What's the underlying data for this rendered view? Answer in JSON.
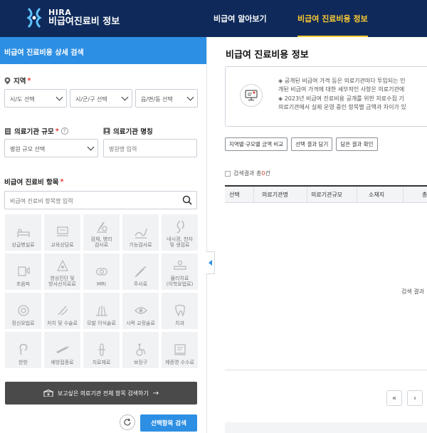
{
  "header": {
    "logo_en": "HIRA",
    "logo_ko": "비급여진료비 정보",
    "nav": [
      {
        "label": "비급여 알아보기"
      },
      {
        "label": "비급여 진료비용 정보"
      }
    ]
  },
  "left": {
    "title": "비급여 진료비용 상세 검색",
    "region": {
      "label": "지역",
      "required": "*",
      "sido": "시/도 선택",
      "sigungu": "시/군/구 선택",
      "eupmyeon": "읍/면/동 선택"
    },
    "scale": {
      "label": "의료기관 규모",
      "required": "*",
      "help": "?",
      "placeholder": "병원 규모 선택"
    },
    "name": {
      "label": "의료기관 명칭",
      "placeholder": "병원명 입력"
    },
    "items": {
      "label": "비급여 진료비 항목",
      "required": "*",
      "search_placeholder": "비급여 진료비 항목명 입력",
      "categories": [
        {
          "icon": "bed-icon",
          "label": "상급병실료"
        },
        {
          "icon": "counseling-icon",
          "label": "교육상담료"
        },
        {
          "icon": "pathology-icon",
          "label": "검체, 병리\n검사료"
        },
        {
          "icon": "function-test-icon",
          "label": "기능검사료"
        },
        {
          "icon": "endoscopy-icon",
          "label": "내시경, 천자\n및 생검료"
        },
        {
          "icon": "ultrasound-icon",
          "label": "초음파"
        },
        {
          "icon": "radiology-icon",
          "label": "영상진단 및\n방사선치료료"
        },
        {
          "icon": "mri-icon",
          "label": "MRI"
        },
        {
          "icon": "injection-icon",
          "label": "주사료"
        },
        {
          "icon": "therapy-icon",
          "label": "물리치료\n(이학요법료)"
        },
        {
          "icon": "psychiatry-icon",
          "label": "정신요법료"
        },
        {
          "icon": "surgery-icon",
          "label": "처치 및 수술료"
        },
        {
          "icon": "hair-icon",
          "label": "모발 이식술료"
        },
        {
          "icon": "eye-icon",
          "label": "시력 교정술료"
        },
        {
          "icon": "tooth-icon",
          "label": "치과"
        },
        {
          "icon": "ear-icon",
          "label": "한방"
        },
        {
          "icon": "vaccine-icon",
          "label": "예방접종료"
        },
        {
          "icon": "material-icon",
          "label": "치료재료"
        },
        {
          "icon": "wheelchair-icon",
          "label": "보장구"
        },
        {
          "icon": "certificate-icon",
          "label": "제증명 수수료"
        }
      ]
    },
    "full_search": "보고싶은 의료기관 전체 항목 검색하기",
    "full_search_arrow": "→",
    "submit": "선택항목 검색"
  },
  "right": {
    "title": "비급여 진료비용 정보",
    "notice_lines": [
      "◈ 공개된 비급여 가격 등은 의료기관마다 투입되는 인",
      "개된 비급여 가격에 대한 세부적인 사항은 의료기관에",
      "◈ 2023년 비급여 진료비용 공개를 위한 자료수집 기",
      "의료기관에서 실제 운영 중인 항목별 금액과 차이가 있"
    ],
    "buttons": [
      "지역별·규모별 금액 비교",
      "선택 결과 담기",
      "담은 결과 확인"
    ],
    "count_prefix": "검색결과 총",
    "count_value": "0",
    "count_suffix": "건",
    "columns": [
      "선택",
      "의료기관명",
      "의료기관규모",
      "소재지",
      "총"
    ],
    "empty": "검색 결과",
    "pager": [
      "«",
      "‹"
    ]
  },
  "colors": {
    "header_bg": "#0f2a5a",
    "accent": "#2d8fe3",
    "active_nav": "#ffcc33",
    "required": "#e2372b"
  }
}
